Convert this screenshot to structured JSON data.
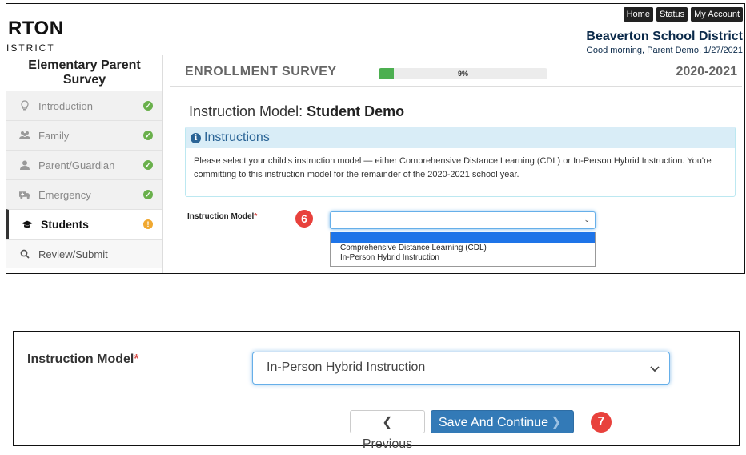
{
  "logo": {
    "main": "RTON",
    "sub": "ISTRICT"
  },
  "topnav": {
    "home": "Home",
    "status": "Status",
    "account": "My Account"
  },
  "district": "Beaverton School District",
  "greeting": "Good morning, Parent Demo, 1/27/2021",
  "sidebar": {
    "title": "Elementary Parent Survey",
    "items": [
      {
        "label": "Introduction",
        "icon": "lightbulb-icon",
        "status": "complete"
      },
      {
        "label": "Family",
        "icon": "users-icon",
        "status": "complete"
      },
      {
        "label": "Parent/Guardian",
        "icon": "user-icon",
        "status": "complete"
      },
      {
        "label": "Emergency",
        "icon": "ambulance-icon",
        "status": "complete"
      },
      {
        "label": "Students",
        "icon": "graduation-cap-icon",
        "status": "warning"
      },
      {
        "label": "Review/Submit",
        "icon": "search-icon",
        "status": ""
      }
    ]
  },
  "header": {
    "title": "ENROLLMENT SURVEY",
    "progress_label": "9%",
    "progress_value": 0.09,
    "year": "2020-2021"
  },
  "section": {
    "heading_prefix": "Instruction Model: ",
    "heading_name": "Student Demo"
  },
  "instructions": {
    "title": "Instructions",
    "body": "Please select your child's instruction model — either Comprehensive Distance Learning (CDL) or In-Person Hybrid Instruction. You're committing to this instruction model for the remainder of the 2020-2021 school year."
  },
  "field": {
    "label": "Instruction Model",
    "required_mark": "*",
    "options": [
      "Comprehensive Distance Learning (CDL)",
      "In-Person Hybrid Instruction"
    ],
    "selected": "In-Person Hybrid Instruction"
  },
  "steps": {
    "step6": "6",
    "step7": "7"
  },
  "buttons": {
    "previous": "Previous",
    "save": "Save And Continue"
  },
  "colors": {
    "accent": "#337ab7",
    "badge": "#e8413c",
    "progress": "#4caf50",
    "info_bg": "#d9edf7"
  }
}
